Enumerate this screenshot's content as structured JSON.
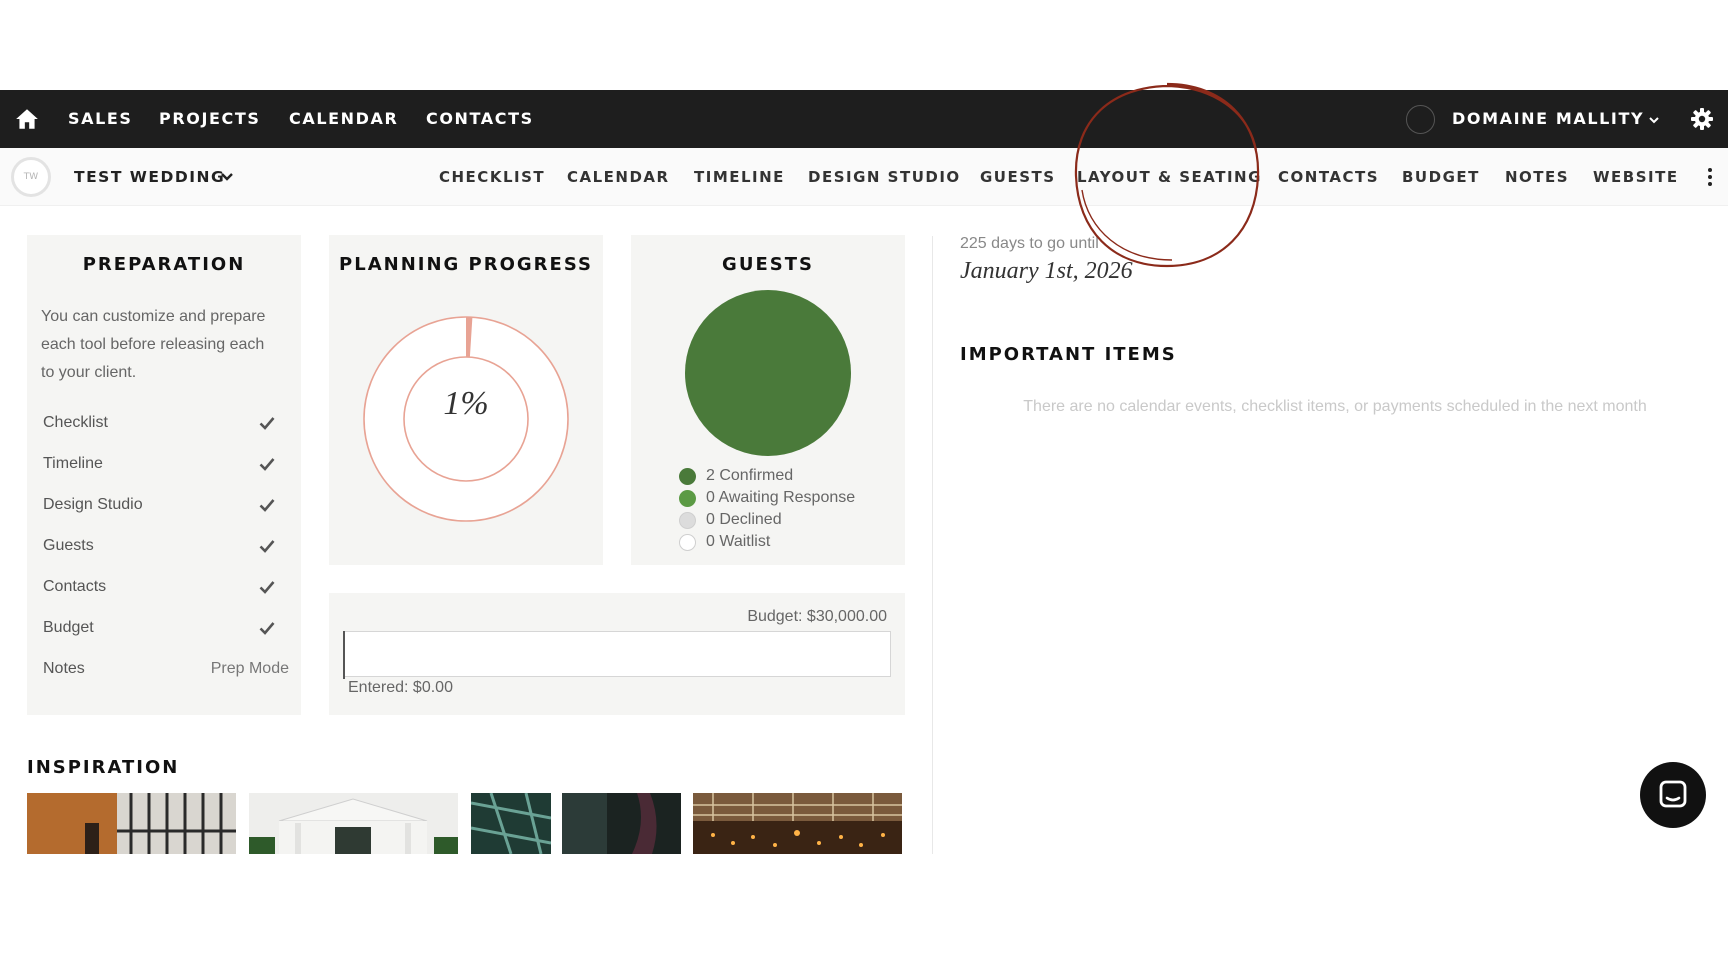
{
  "topnav": {
    "items": [
      "SALES",
      "PROJECTS",
      "CALENDAR",
      "CONTACTS"
    ],
    "user_name": "DOMAINE MALLITY"
  },
  "subnav": {
    "badge": "TW",
    "project_name": "TEST WEDDING",
    "tabs": [
      "CHECKLIST",
      "CALENDAR",
      "TIMELINE",
      "DESIGN STUDIO",
      "GUESTS",
      "LAYOUT & SEATING",
      "CONTACTS",
      "BUDGET",
      "NOTES",
      "WEBSITE"
    ]
  },
  "preparation": {
    "title": "PREPARATION",
    "description": "You can customize and prepare each tool before releasing each to your client.",
    "items": [
      "Checklist",
      "Timeline",
      "Design Studio",
      "Guests",
      "Contacts",
      "Budget"
    ],
    "notes_label": "Notes",
    "notes_mode": "Prep Mode"
  },
  "planning_progress": {
    "title": "PLANNING PROGRESS",
    "value": 1,
    "label": "1%"
  },
  "guests": {
    "title": "GUESTS",
    "legend": [
      {
        "label": "2 Confirmed",
        "count": 2,
        "color": "#4a7a3a"
      },
      {
        "label": "0 Awaiting Response",
        "count": 0,
        "color": "#5b9a44"
      },
      {
        "label": "0 Declined",
        "count": 0,
        "color": "#dcdcdc"
      },
      {
        "label": "0 Waitlist",
        "count": 0,
        "color": "#ffffff"
      }
    ]
  },
  "budget": {
    "total_label": "Budget: $30,000.00",
    "entered_label": "Entered: $0.00",
    "entered_fraction": 0
  },
  "inspiration": {
    "title": "INSPIRATION"
  },
  "event": {
    "countdown": "225 days to go until",
    "date": "January 1st, 2026"
  },
  "important_items": {
    "title": "IMPORTANT ITEMS",
    "empty_message": "There are no calendar events, checklist items, or payments scheduled in the next month"
  },
  "colors": {
    "nav_bg": "#1e1e1e",
    "card_bg": "#f5f5f3",
    "progress_ring": "#e8a394",
    "confirmed_green": "#4a7a3a",
    "highlight_circle": "#8b2a1a"
  }
}
